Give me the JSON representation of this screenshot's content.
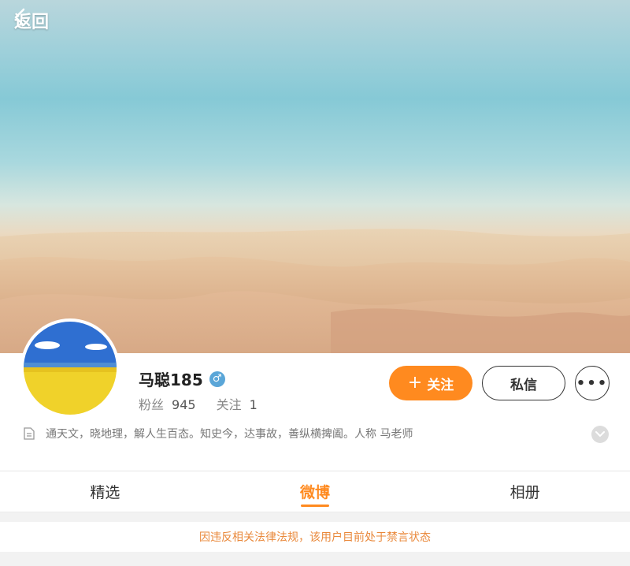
{
  "nav": {
    "back_label": "返回"
  },
  "profile": {
    "name": "马聪185",
    "gender_symbol": "♂",
    "stats": [
      {
        "label": "粉丝",
        "value": "945"
      },
      {
        "label": "关注",
        "value": "1"
      }
    ],
    "bio": "通天文，晓地理，解人生百态。知史今，达事故，善纵横捭阖。人称 马老师",
    "buttons": {
      "follow": "关注",
      "message": "私信",
      "more": "•••"
    }
  },
  "tabs": [
    {
      "label": "精选",
      "active": false
    },
    {
      "label": "微博",
      "active": true
    },
    {
      "label": "相册",
      "active": false
    }
  ],
  "notice": "因违反相关法律法规，该用户目前处于禁言状态",
  "colors": {
    "accent": "#ff8a1f",
    "gender": "#5aa6d8",
    "notice": "#e9883a"
  }
}
